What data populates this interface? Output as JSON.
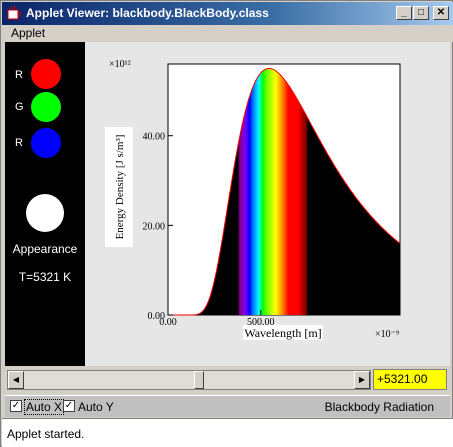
{
  "window": {
    "title": "Applet Viewer: blackbody.BlackBody.class",
    "minimize_glyph": "_",
    "maximize_glyph": "□",
    "close_glyph": "✕"
  },
  "menu": {
    "applet": "Applet"
  },
  "left_panel": {
    "channels": [
      {
        "label": "R",
        "color": "#ff0000"
      },
      {
        "label": "G",
        "color": "#00ff00"
      },
      {
        "label": "R",
        "color": "#0000ff"
      }
    ],
    "appearance_color": "#ffffff",
    "appearance_label": "Appearance",
    "temperature_label": "T=5321 K"
  },
  "controls": {
    "scroll_left_glyph": "◀",
    "scroll_right_glyph": "▶",
    "slider_fraction": 0.53,
    "temperature_value": "+5321.00",
    "auto_x_label": "Auto X",
    "auto_x_checked": true,
    "auto_y_label": "Auto Y",
    "auto_y_checked": true,
    "check_glyph": "✓",
    "chart_name": "Blackbody Radiation"
  },
  "status": {
    "text": "Applet started."
  },
  "chart_data": {
    "type": "area",
    "xlabel": "Wavelength [m]",
    "ylabel": "Energy Density [J s/m³]",
    "x_scale_label": "×10⁻⁹",
    "y_scale_label": "×10¹²",
    "xlim": [
      0,
      1250
    ],
    "ylim": [
      0,
      56
    ],
    "x_ticks": [
      {
        "value": 0,
        "label": "0.00"
      },
      {
        "value": 500,
        "label": "500.00"
      }
    ],
    "y_ticks": [
      {
        "value": 0,
        "label": "0.00"
      },
      {
        "value": 20,
        "label": "20.00"
      },
      {
        "value": 40,
        "label": "40.00"
      }
    ],
    "temperature_K": 5321,
    "peak_wavelength_nm": 545,
    "peak_value": 55,
    "visible_range_nm": [
      380,
      750
    ],
    "curve_color": "#ff0000",
    "grid": false
  }
}
